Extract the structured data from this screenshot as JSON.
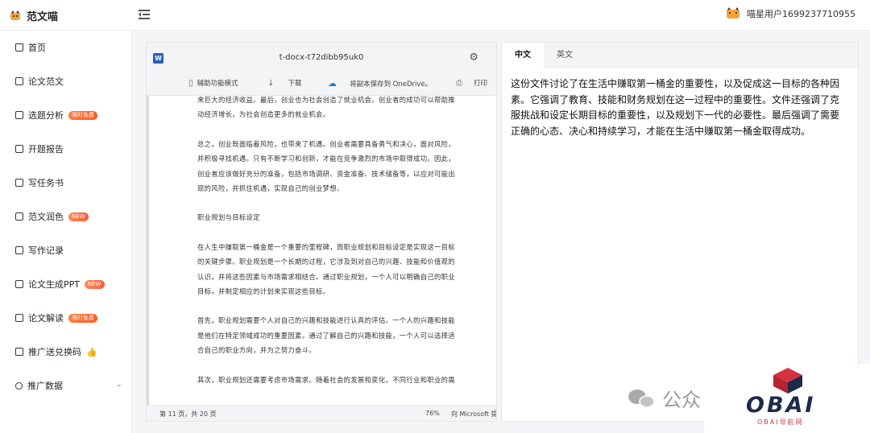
{
  "app": {
    "title": "范文喵"
  },
  "user": {
    "name": "喵星用户1699237710955"
  },
  "sidebar": {
    "items": [
      {
        "label": "首页",
        "icon": "home-icon",
        "badge": ""
      },
      {
        "label": "论文范文",
        "icon": "document-icon",
        "badge": ""
      },
      {
        "label": "选题分析",
        "icon": "analysis-icon",
        "badge": "限时免费"
      },
      {
        "label": "开题报告",
        "icon": "report-icon",
        "badge": ""
      },
      {
        "label": "写任务书",
        "icon": "task-icon",
        "badge": ""
      },
      {
        "label": "范文润色",
        "icon": "polish-icon",
        "badge": "NEW"
      },
      {
        "label": "写作记录",
        "icon": "record-icon",
        "badge": ""
      },
      {
        "label": "论文生成PPT",
        "icon": "ppt-icon",
        "badge": "NEW"
      },
      {
        "label": "论文解读",
        "icon": "interpret-icon",
        "badge": "限时免费"
      },
      {
        "label": "推广送兑换码",
        "icon": "gift-icon",
        "badge": "👍"
      },
      {
        "label": "推广数据",
        "icon": "share-icon",
        "badge": ""
      }
    ]
  },
  "doc": {
    "filename": "t-docx-t72dibb95uk0",
    "word_icon": "W",
    "toolbar": {
      "accessibility": "辅助功能模式",
      "download": "下载",
      "onedrive": "将副本保存到 OneDrive。",
      "print": "打印"
    },
    "paragraphs": [
      [
        "来巨大的经济收益。最后，创业也为社会创造了就业机会。创业者的成功可以帮助推",
        "动经济增长，为社会创造更多的就业机会。"
      ],
      [
        "总之，创业既面临着风险，也带来了机遇。创业者需要具备勇气和决心，面对风险，",
        "并积极寻找机遇。只有不断学习和创新，才能在竞争激烈的市场中取得成功。因此，",
        "创业者应该做好充分的准备，包括市场调研、资金准备、技术储备等，以应对可能出",
        "现的风险，并抓住机遇，实现自己的创业梦想。"
      ],
      [
        "职业规划与目标设定"
      ],
      [
        "在人生中赚取第一桶金是一个重要的里程碑，而职业规划和目标设定是实现这一目标",
        "的关键步骤。职业规划是一个长期的过程，它涉及到对自己的兴趣、技能和价值观的",
        "认识，并将这些因素与市场需求相结合。通过职业规划，一个人可以明确自己的职业",
        "目标，并制定相应的计划来实现这些目标。"
      ],
      [
        "首先，职业规划需要个人对自己的兴趣和技能进行认真的评估。一个人的兴趣和技能",
        "是他们在特定领域成功的重要因素。通过了解自己的兴趣和技能，一个人可以选择适",
        "合自己的职业方向，并为之努力奋斗。"
      ],
      [
        "其次，职业规划还需要考虑市场需求。随着社会的发展和变化，不同行业和职业的需"
      ]
    ],
    "footer": {
      "page": "第 11 页，共 20 页",
      "zoom": "76%",
      "provider": "向 Microsoft 提供反馈"
    }
  },
  "summary": {
    "tabs": [
      "中文",
      "英文"
    ],
    "active_tab": "中文",
    "text": "这份文件讨论了在生活中赚取第一桶金的重要性，以及促成这一目标的各种因素。它强调了教育、技能和财务规划在这一过程中的重要性。文件还强调了克服挑战和设定长期目标的重要性，以及规划下一代的必要性。最后强调了需要正确的心态、决心和持续学习，才能在生活中赚取第一桶金取得成功。"
  },
  "watermark": {
    "gzh": "公众",
    "brand": "OBAI",
    "brand_sub": "OBAI导航网"
  },
  "colors": {
    "accent": "#f2a33a",
    "badge": "#ff5a1f",
    "word": "#2b5fb8",
    "onedrive": "#1e7fd9"
  }
}
